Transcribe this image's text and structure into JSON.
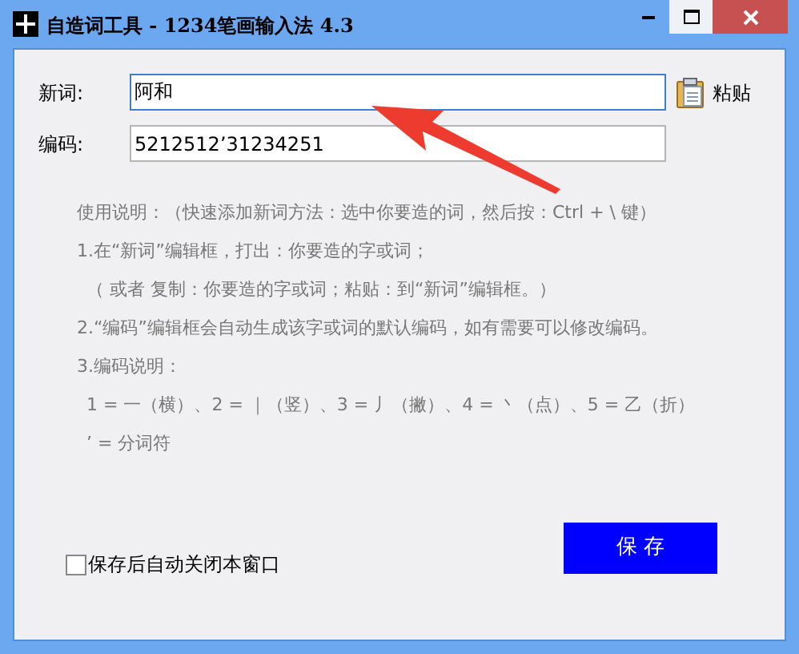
{
  "window": {
    "title": "自造词工具 - 1234笔画输入法 4.3"
  },
  "fields": [
    {
      "label": "新词:",
      "value": "阿和",
      "focused": true
    },
    {
      "label": "编码:",
      "value": "5212512’31234251",
      "focused": false
    }
  ],
  "paste_button": {
    "label": "粘贴"
  },
  "instructions": [
    {
      "text": "使用说明：（快速添加新词方法：选中你要造的词，然后按：Ctrl + \\ 键）",
      "indented": false
    },
    {
      "text": "1.在“新词”编辑框，打出：你要造的字或词；",
      "indented": false
    },
    {
      "text": "（ 或者 复制：你要造的字或词；粘贴：到“新词”编辑框。）",
      "indented": true
    },
    {
      "text": "2.“编码”编辑框会自动生成该字或词的默认编码，如有需要可以修改编码。",
      "indented": false
    },
    {
      "text": "3.编码说明：",
      "indented": false
    },
    {
      "text": "1 = 一（横）、2 = ｜（竖）、3 = 丿（撇）、4 = 丶（点）、5 = 乙（折）",
      "indented": true
    },
    {
      "text": "’ = 分词符",
      "indented": true
    }
  ],
  "auto_close": {
    "label": "保存后自动关闭本窗口",
    "checked": false
  },
  "save_button": {
    "label": "保 存"
  }
}
